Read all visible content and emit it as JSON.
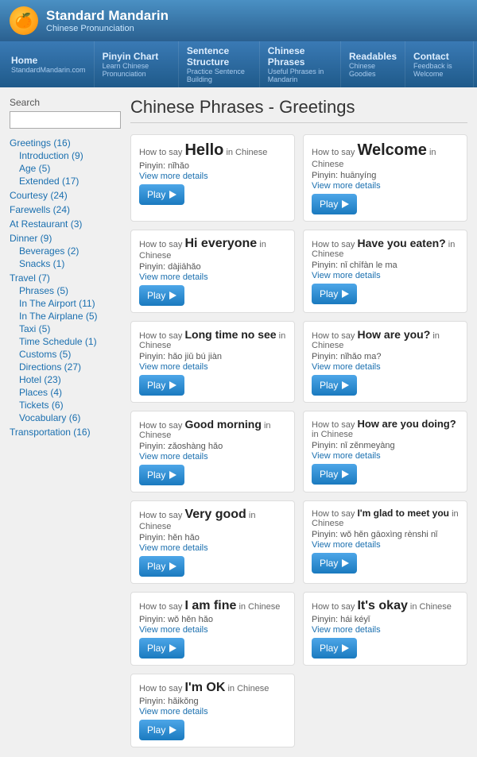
{
  "header": {
    "logo_emoji": "🍊",
    "site_title": "Standard Mandarin",
    "site_subtitle": "Chinese Pronunciation"
  },
  "nav": {
    "items": [
      {
        "label": "Home",
        "sub": "StandardMandarin.com"
      },
      {
        "label": "Pinyin Chart",
        "sub": "Learn Chinese Pronunciation"
      },
      {
        "label": "Sentence Structure",
        "sub": "Practice Sentence Building"
      },
      {
        "label": "Chinese Phrases",
        "sub": "Useful Phrases in Mandarin"
      },
      {
        "label": "Readables",
        "sub": "Chinese Goodies"
      },
      {
        "label": "Contact",
        "sub": "Feedback is Welcome"
      }
    ]
  },
  "page_title": "Chinese Phrases - Greetings",
  "sidebar": {
    "search_label": "Search",
    "search_placeholder": "",
    "categories": [
      {
        "name": "Greetings (16)",
        "sub": [
          {
            "name": "Introduction (9)"
          },
          {
            "name": "Age (5)"
          },
          {
            "name": "Extended (17)"
          }
        ]
      },
      {
        "name": "Courtesy (24)",
        "sub": []
      },
      {
        "name": "Farewells (24)",
        "sub": []
      },
      {
        "name": "At Restaurant (3)",
        "sub": []
      },
      {
        "name": "Dinner (9)",
        "sub": [
          {
            "name": "Beverages (2)"
          },
          {
            "name": "Snacks (1)"
          }
        ]
      },
      {
        "name": "Travel (7)",
        "sub": [
          {
            "name": "Phrases (5)"
          },
          {
            "name": "In The Airport (11)"
          },
          {
            "name": "In The Airplane (5)"
          },
          {
            "name": "Taxi (5)"
          },
          {
            "name": "Time Schedule (1)"
          },
          {
            "name": "Customs (5)"
          },
          {
            "name": "Directions (27)"
          },
          {
            "name": "Hotel (23)"
          },
          {
            "name": "Places (4)"
          },
          {
            "name": "Tickets (6)"
          },
          {
            "name": "Vocabulary (6)"
          }
        ]
      },
      {
        "name": "Transportation (16)",
        "sub": []
      }
    ]
  },
  "phrases": [
    {
      "how": "How to say",
      "name": "Hello",
      "name_size": "lg",
      "suffix": "in Chinese",
      "pinyin_label": "Pinyin:",
      "pinyin": "nǐhǎo",
      "details": "View more details",
      "play_label": "Play"
    },
    {
      "how": "How to say",
      "name": "Welcome",
      "name_size": "lg",
      "suffix": "in Chinese",
      "pinyin_label": "Pinyin:",
      "pinyin": "huānyíng",
      "details": "View more details",
      "play_label": "Play"
    },
    {
      "how": "How to say",
      "name": "Hi everyone",
      "name_size": "md",
      "suffix": "in Chinese",
      "pinyin_label": "Pinyin:",
      "pinyin": "dàjiāhǎo",
      "details": "View more details",
      "play_label": "Play"
    },
    {
      "how": "How to say",
      "name": "Have you eaten?",
      "name_size": "sm",
      "suffix": "in Chinese",
      "pinyin_label": "Pinyin:",
      "pinyin": "nǐ chīfàn le ma",
      "details": "View more details",
      "play_label": "Play"
    },
    {
      "how": "How to say",
      "name": "Long time no see",
      "name_size": "sm",
      "suffix": "in Chinese",
      "pinyin_label": "Pinyin:",
      "pinyin": "hǎo jiǔ bú jiàn",
      "details": "View more details",
      "play_label": "Play"
    },
    {
      "how": "How to say",
      "name": "How are you?",
      "name_size": "sm",
      "suffix": "in Chinese",
      "pinyin_label": "Pinyin:",
      "pinyin": "nǐhǎo ma?",
      "details": "View more details",
      "play_label": "Play"
    },
    {
      "how": "How to say",
      "name": "Good morning",
      "name_size": "sm",
      "suffix": "in Chinese",
      "pinyin_label": "Pinyin:",
      "pinyin": "zǎoshàng hǎo",
      "details": "View more details",
      "play_label": "Play"
    },
    {
      "how": "How to say",
      "name": "How are you doing?",
      "name_size": "xs",
      "suffix": "in Chinese",
      "pinyin_label": "Pinyin:",
      "pinyin": "nǐ zěnmeyàng",
      "details": "View more details",
      "play_label": "Play"
    },
    {
      "how": "How to say",
      "name": "Very good",
      "name_size": "md",
      "suffix": "in Chinese",
      "pinyin_label": "Pinyin:",
      "pinyin": "hěn hǎo",
      "details": "View more details",
      "play_label": "Play"
    },
    {
      "how": "How to say",
      "name": "I'm glad to meet you",
      "name_size": "xs",
      "suffix": "in Chinese",
      "pinyin_label": "Pinyin:",
      "pinyin": "wǒ hěn gāoxìng rènshi nǐ",
      "details": "View more details",
      "play_label": "Play"
    },
    {
      "how": "How to say",
      "name": "I am fine",
      "name_size": "md",
      "suffix": "in Chinese",
      "pinyin_label": "Pinyin:",
      "pinyin": "wǒ hěn hǎo",
      "details": "View more details",
      "play_label": "Play"
    },
    {
      "how": "How to say",
      "name": "It's okay",
      "name_size": "md",
      "suffix": "in Chinese",
      "pinyin_label": "Pinyin:",
      "pinyin": "hái kéyǐ",
      "details": "View more details",
      "play_label": "Play"
    },
    {
      "how": "How to say",
      "name": "I'm OK",
      "name_size": "md",
      "suffix": "in Chinese",
      "pinyin_label": "Pinyin:",
      "pinyin": "hǎikǒng",
      "details": "View more details",
      "play_label": "Play"
    }
  ]
}
